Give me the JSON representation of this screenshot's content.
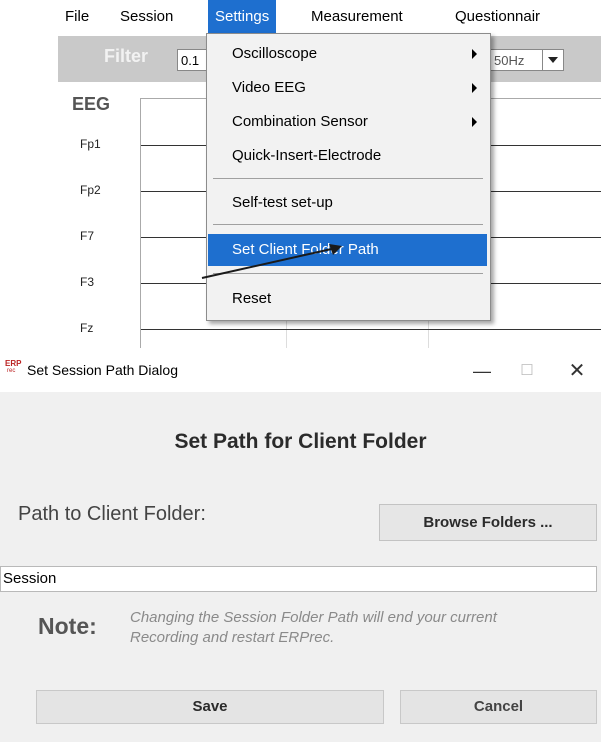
{
  "menubar": {
    "items": [
      "File",
      "Session",
      "Settings",
      "Measurement",
      "Questionnair"
    ],
    "active": "Settings",
    "accent_color": "#1e6fcf"
  },
  "filter_bar": {
    "label": "Filter",
    "input_value": "0.1",
    "right_value": "50Hz"
  },
  "eeg": {
    "title": "EEG",
    "channels": [
      "Fp1",
      "Fp2",
      "F7",
      "F3",
      "Fz"
    ]
  },
  "settings_menu": {
    "items": [
      {
        "label": "Oscilloscope",
        "submenu": true
      },
      {
        "label": "Video EEG",
        "submenu": true
      },
      {
        "label": "Combination Sensor",
        "submenu": true
      },
      {
        "label": "Quick-Insert-Electrode",
        "submenu": false
      },
      {
        "label": "Self-test set-up",
        "submenu": false
      },
      {
        "label": "Set Client Folder Path",
        "submenu": false,
        "highlighted": true
      },
      {
        "label": "Reset",
        "submenu": false
      }
    ]
  },
  "dialog": {
    "title": "Set Session Path Dialog",
    "app_icon_text": "ERP",
    "app_icon_subtext": "rec",
    "window_controls": {
      "minimize": "—",
      "maximize": "☐",
      "close": "✕"
    },
    "heading": "Set Path for Client Folder",
    "path_label": "Path to Client Folder:",
    "browse_label": "Browse Folders ...",
    "path_value": "Session",
    "note_label": "Note:",
    "note_text": "Changing the Session Folder Path will end your current Recording and restart ERPrec.",
    "save_label": "Save",
    "cancel_label": "Cancel"
  }
}
